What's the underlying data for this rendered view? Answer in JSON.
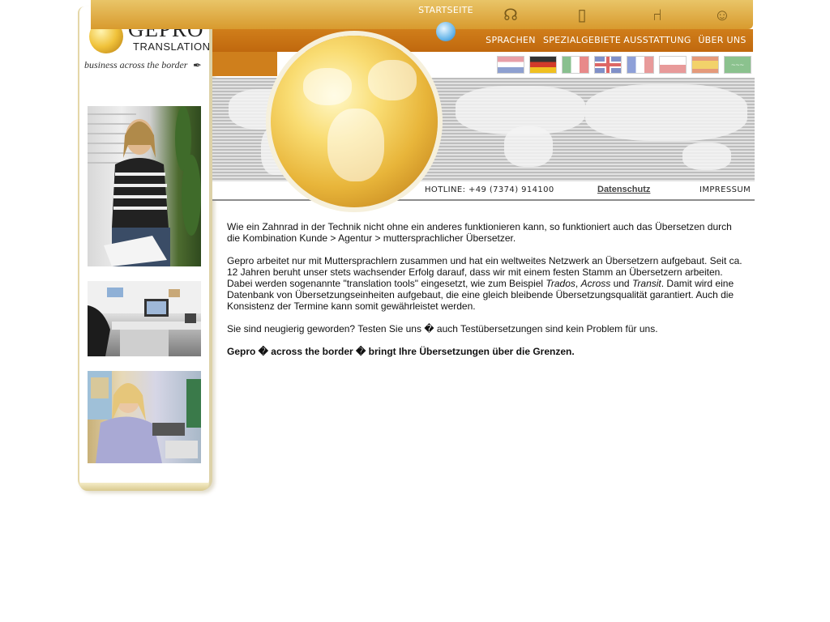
{
  "logo": {
    "brand": "GEPRO",
    "sub": "TRANSLATION",
    "tagline": "business across the border"
  },
  "nav": {
    "home_label": "STARTSEITE",
    "items": [
      {
        "label": "SPRACHEN",
        "icon": "headset-icon"
      },
      {
        "label": "SPEZIALGEBIETE",
        "icon": "clipboard-icon"
      },
      {
        "label": "AUSSTATTUNG",
        "icon": "chair-icon"
      },
      {
        "label": "ÜBER UNS",
        "icon": "person-icon"
      }
    ]
  },
  "flags": [
    "nl",
    "de",
    "it",
    "gb",
    "fr",
    "pl",
    "es",
    "sa"
  ],
  "header": {
    "hotline": "HOTLINE: +49 (7374) 914100",
    "datenschutz": "Datenschutz",
    "impressum": "IMPRESSUM"
  },
  "content": {
    "p1": "Wie ein Zahnrad in der Technik nicht ohne ein anderes funktionieren kann, so funktioniert auch das Übersetzen durch die Kombination Kunde > Agentur > muttersprachlicher Übersetzer.",
    "p2_a": "Gepro arbeitet nur mit Muttersprachlern zusammen und hat ein weltweites Netzwerk an Übersetzern aufgebaut. Seit ca. 12 Jahren beruht unser stets wachsender Erfolg darauf, dass wir mit einem festen Stamm an Übersetzern arbeiten. Dabei werden sogenannte \"translation tools\" eingesetzt, wie zum Beispiel ",
    "p2_trados": "Trados",
    "p2_sep1": ", ",
    "p2_across": "Across",
    "p2_und": " und ",
    "p2_transit": "Transit",
    "p2_b": ". Damit wird eine Datenbank von Übersetzungseinheiten aufgebaut, die eine gleich bleibende Übersetzungsqualität garantiert. Auch die Konsistenz der Termine kann somit gewährleistet werden.",
    "p3": "Sie sind neugierig geworden? Testen Sie uns � auch Testübersetzungen sind kein Problem für uns.",
    "p4": "Gepro � across the border � bringt Ihre Übersetzungen über die Grenzen."
  },
  "colors": {
    "topbar": "#e0b04a",
    "navbar": "#c8731a",
    "globe": "#f0c23a"
  }
}
